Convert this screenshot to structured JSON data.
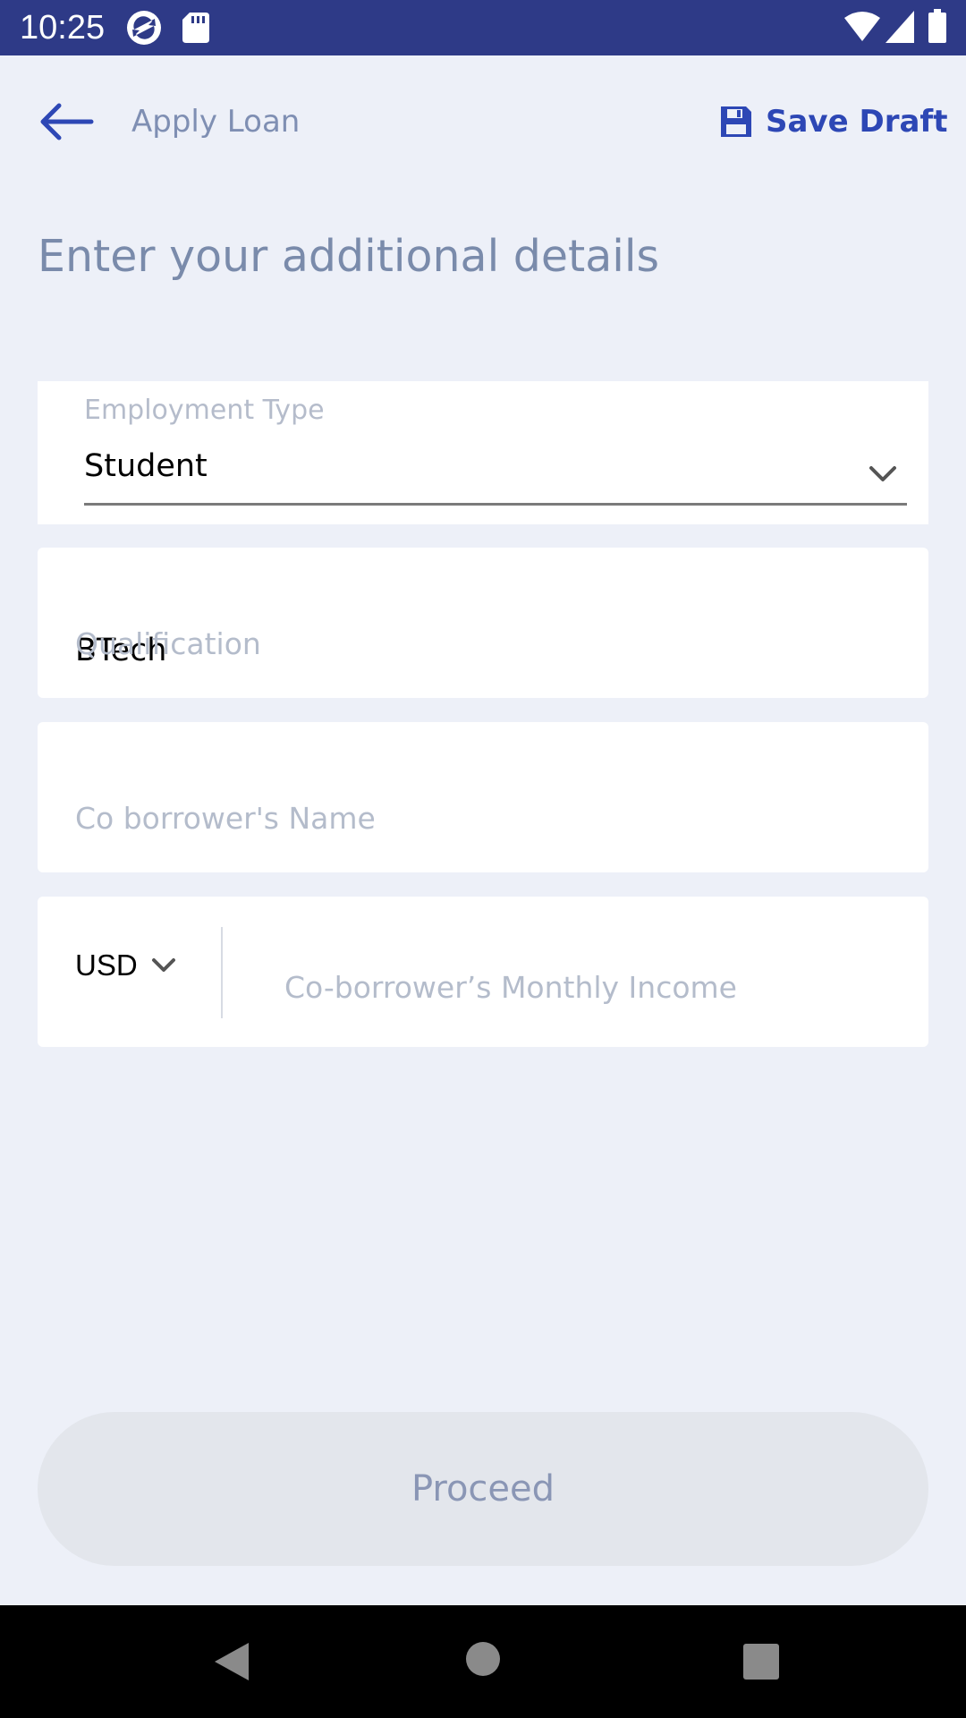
{
  "status_bar": {
    "time": "10:25",
    "icons": [
      "sync-app-icon",
      "sd-card-icon",
      "wifi-icon",
      "signal-icon",
      "battery-icon"
    ]
  },
  "header": {
    "back_icon": "arrow-left-icon",
    "title": "Apply Loan",
    "save_icon": "save-icon",
    "save_label": "Save Draft"
  },
  "page": {
    "heading": "Enter your additional details"
  },
  "form": {
    "employment_type": {
      "label": "Employment Type",
      "value": "Student",
      "icon": "chevron-down-icon"
    },
    "qualification": {
      "placeholder": "Qualification",
      "value": "BTech"
    },
    "co_borrower_name": {
      "placeholder": "Co borrower's Name",
      "value": ""
    },
    "co_borrower_income": {
      "currency": "USD",
      "placeholder": "Co-borrower’s Monthly Income",
      "value": ""
    }
  },
  "actions": {
    "proceed_label": "Proceed"
  },
  "nav_bar": {
    "icons": [
      "nav-back-icon",
      "nav-home-icon",
      "nav-recents-icon"
    ]
  },
  "colors": {
    "status_bar": "#2e3a87",
    "background": "#edf0f8",
    "accent": "#2d47b5",
    "muted_text": "#7a8bab",
    "placeholder": "#b4bccb",
    "button_disabled_bg": "#e3e6ec",
    "button_disabled_text": "#8a96b5"
  }
}
